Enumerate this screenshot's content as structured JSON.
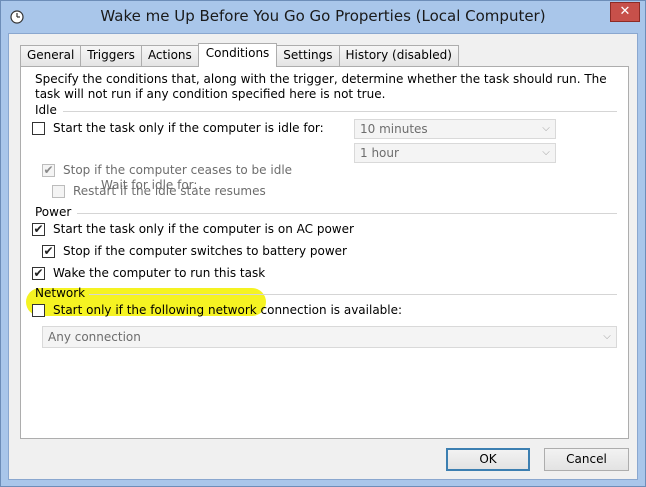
{
  "window": {
    "title": "Wake me Up Before You Go Go Properties (Local Computer)",
    "close_label": "✕",
    "accent": "#a9c6ea",
    "close_color": "#c7504a"
  },
  "tabs": [
    {
      "label": "General",
      "active": false
    },
    {
      "label": "Triggers",
      "active": false
    },
    {
      "label": "Actions",
      "active": false
    },
    {
      "label": "Conditions",
      "active": true
    },
    {
      "label": "Settings",
      "active": false
    },
    {
      "label": "History (disabled)",
      "active": false
    }
  ],
  "conditions": {
    "description": "Specify the conditions that, along with the trigger, determine whether the task should run.  The task will not run  if any condition specified here is not true.",
    "idle": {
      "group_label": "Idle",
      "start_if_idle": {
        "label": "Start the task only if the computer is idle for:",
        "checked": false,
        "enabled": true
      },
      "idle_duration": {
        "value": "10 minutes",
        "enabled": false
      },
      "wait_label": "Wait for idle for:",
      "wait_duration": {
        "value": "1 hour",
        "enabled": false
      },
      "stop_if_not_idle": {
        "label": "Stop if the computer ceases to be idle",
        "checked": true,
        "enabled": false
      },
      "restart_if_idle": {
        "label": "Restart if the idle state resumes",
        "checked": false,
        "enabled": false
      }
    },
    "power": {
      "group_label": "Power",
      "ac_power": {
        "label": "Start the task only if the computer is on AC power",
        "checked": true,
        "enabled": true
      },
      "battery_stop": {
        "label": "Stop if the computer switches to battery power",
        "checked": true,
        "enabled": true
      },
      "wake": {
        "label": "Wake the computer to run this task",
        "checked": true,
        "enabled": true,
        "highlight_color": "#f4f20a"
      }
    },
    "network": {
      "group_label": "Network",
      "only_if_network": {
        "label": "Start only if the following network connection is available:",
        "checked": false,
        "enabled": true
      },
      "connection": {
        "value": "Any connection",
        "enabled": false
      }
    }
  },
  "buttons": {
    "ok": "OK",
    "cancel": "Cancel"
  },
  "icons": {
    "check": "✔",
    "dropdown": "⌵",
    "window": "clock-icon"
  }
}
